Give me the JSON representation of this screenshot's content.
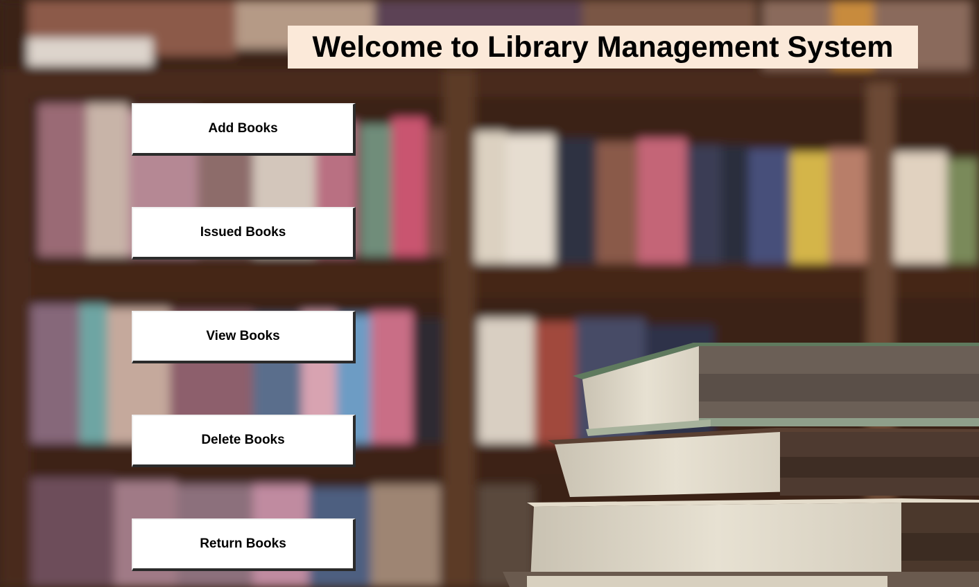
{
  "window": {
    "title": "Welcome to Library Management System"
  },
  "menu": {
    "buttons": [
      {
        "label": "Add Books"
      },
      {
        "label": "Issued Books"
      },
      {
        "label": "View Books"
      },
      {
        "label": "Delete Books"
      },
      {
        "label": "Return Books"
      }
    ]
  },
  "colors": {
    "title_background": "#fbe9d9",
    "button_background": "#ffffff",
    "button_shadow": "#2b2b2b"
  },
  "background": {
    "image": "blurred-library-bookshelf-with-book-stack"
  }
}
